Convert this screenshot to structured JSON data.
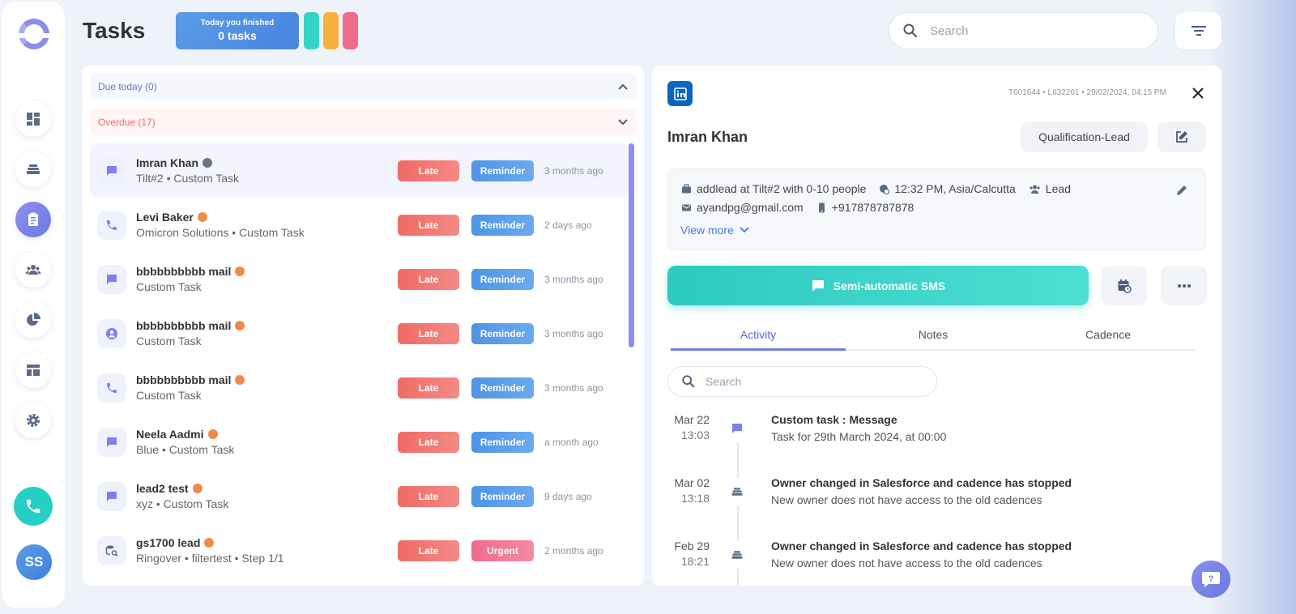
{
  "header": {
    "title": "Tasks",
    "finished_line1": "Today you finished",
    "finished_line2": "0 tasks",
    "search_placeholder": "Search",
    "pill_colors": [
      "#36d3c7",
      "#f8b13e",
      "#f26b8a"
    ]
  },
  "sidebar": {
    "items": [
      {
        "icon": "dashboard-icon"
      },
      {
        "icon": "stack-icon"
      },
      {
        "icon": "tasks-clipboard-icon",
        "active": true
      },
      {
        "icon": "people-icon"
      },
      {
        "icon": "pie-chart-icon"
      },
      {
        "icon": "layout-icon"
      },
      {
        "icon": "gear-icon"
      }
    ],
    "user_initials": "SS"
  },
  "sections": {
    "due_today": "Due today (0)",
    "overdue": "Overdue (17)"
  },
  "tasks": [
    {
      "name": "Imran Khan",
      "sub": "Tilt#2 • Custom Task",
      "status": "Late",
      "tag": "Reminder",
      "ago": "3 months ago",
      "icon": "message-icon"
    },
    {
      "name": "Levi Baker",
      "sub": "Omicron Solutions • Custom Task",
      "status": "Late",
      "tag": "Reminder",
      "ago": "2 days ago",
      "icon": "phone-icon"
    },
    {
      "name": "bbbbbbbbbb mail",
      "sub": "Custom Task",
      "status": "Late",
      "tag": "Reminder",
      "ago": "3 months ago",
      "icon": "message-icon"
    },
    {
      "name": "bbbbbbbbbb mail",
      "sub": "Custom Task",
      "status": "Late",
      "tag": "Reminder",
      "ago": "3 months ago",
      "icon": "contact-icon"
    },
    {
      "name": "bbbbbbbbbb mail",
      "sub": "Custom Task",
      "status": "Late",
      "tag": "Reminder",
      "ago": "3 months ago",
      "icon": "phone-icon"
    },
    {
      "name": "Neela Aadmi",
      "sub": "Blue • Custom Task",
      "status": "Late",
      "tag": "Reminder",
      "ago": "a month ago",
      "icon": "message-icon"
    },
    {
      "name": "lead2 test",
      "sub": "xyz • Custom Task",
      "status": "Late",
      "tag": "Reminder",
      "ago": "9 days ago",
      "icon": "message-icon"
    },
    {
      "name": "gs1700 lead",
      "sub": "Ringover • filtertest • Step 1/1",
      "status": "Late",
      "tag": "Urgent",
      "ago": "2 months ago",
      "icon": "data-search-icon"
    }
  ],
  "detail": {
    "meta": "T601644 • L632261 • 29/02/2024, 04:15 PM",
    "name": "Imran Khan",
    "qualification": "Qualification-Lead",
    "info": {
      "company": "addlead at Tilt#2 with 0-10 people",
      "time": "12:32 PM, Asia/Calcutta",
      "type": "Lead",
      "email": "ayandpg@gmail.com",
      "phone": "+917878787878",
      "view_more": "View more"
    },
    "sms_label": "Semi-automatic SMS",
    "tabs": [
      "Activity",
      "Notes",
      "Cadence"
    ],
    "activity_search_placeholder": "Search",
    "activities": [
      {
        "date": "Mar 22",
        "time": "13:03",
        "title": "Custom task : Message",
        "desc": "Task for 29th March 2024, at 00:00",
        "icon": "message-icon"
      },
      {
        "date": "Mar 02",
        "time": "13:18",
        "title": "Owner changed in Salesforce and cadence has stopped",
        "desc": "New owner does not have access to the old cadences",
        "icon": "stack-icon"
      },
      {
        "date": "Feb 29",
        "time": "18:21",
        "title": "Owner changed in Salesforce and cadence has stopped",
        "desc": "New owner does not have access to the old cadences",
        "icon": "stack-icon"
      }
    ]
  }
}
